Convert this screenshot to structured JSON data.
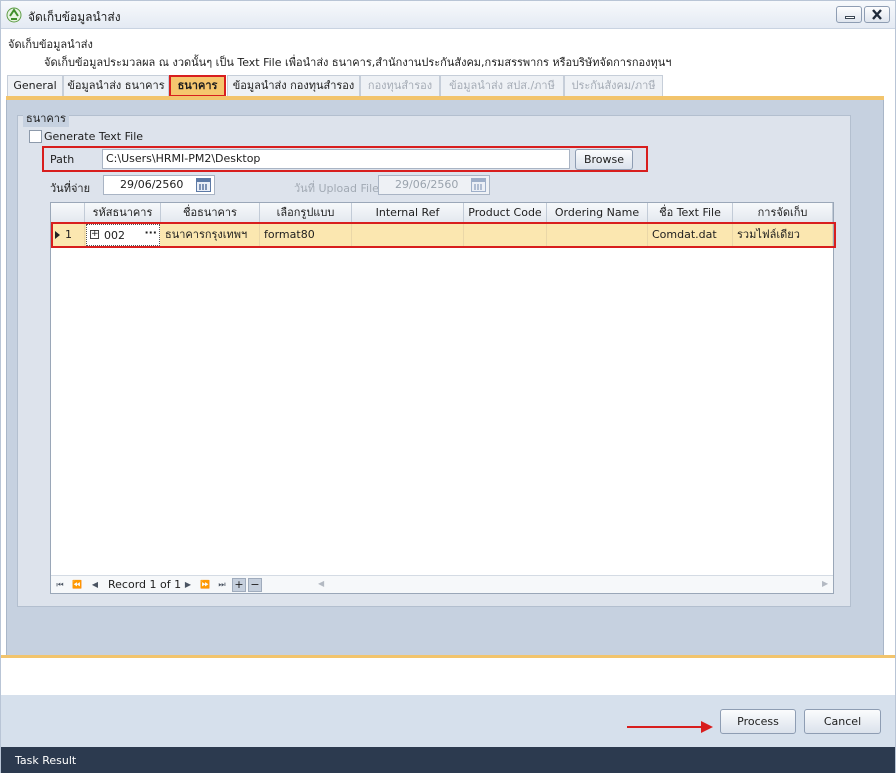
{
  "window": {
    "title": "จัดเก็บข้อมูลนำส่ง",
    "icon": "recycle-app-icon"
  },
  "description": {
    "title": "จัดเก็บข้อมูลนำส่ง",
    "body": "จัดเก็บข้อมูลประมวลผล ณ งวดนั้นๆ เป็น Text File เพื่อนำส่ง ธนาคาร,สำนักงานประกันสังคม,กรมสรรพากร หรือบริษัทจัดการกองทุนฯ"
  },
  "tabs": [
    {
      "label": "General",
      "state": "normal"
    },
    {
      "label": "ข้อมูลนำส่ง ธนาคาร",
      "state": "normal"
    },
    {
      "label": "ธนาคาร",
      "state": "active"
    },
    {
      "label": "ข้อมูลนำส่ง กองทุนสำรอง",
      "state": "normal"
    },
    {
      "label": "กองทุนสำรอง",
      "state": "disabled"
    },
    {
      "label": "ข้อมูลนำส่ง สปส./ภาษี",
      "state": "disabled"
    },
    {
      "label": "ประกันสังคม/ภาษี",
      "state": "disabled"
    }
  ],
  "group": {
    "title": "ธนาคาร",
    "generate_label": "Generate Text File",
    "generate_checked": false,
    "path_label": "Path",
    "path_value": "C:\\Users\\HRMI-PM2\\Desktop",
    "browse_label": "Browse",
    "pay_date_label": "วันที่จ่าย",
    "pay_date_value": "29/06/2560",
    "upload_label": "วันที่ Upload File",
    "upload_value": "29/06/2560"
  },
  "grid": {
    "columns": [
      "รหัสธนาคาร",
      "ชื่อธนาคาร",
      "เลือกรูปแบบ",
      "Internal Ref",
      "Product Code",
      "Ordering Name",
      "ชื่อ Text File",
      "การจัดเก็บ"
    ],
    "rows": [
      {
        "num": "1",
        "code": "002",
        "name": "ธนาคารกรุงเทพฯ",
        "format": "format80",
        "internal_ref": "",
        "product_code": "",
        "ordering_name": "",
        "text_file": "Comdat.dat",
        "storage": "รวมไฟล์เดียว"
      }
    ],
    "navigator": {
      "record_text": "Record 1 of 1"
    }
  },
  "footer": {
    "process_label": "Process",
    "cancel_label": "Cancel"
  },
  "status": {
    "text": "Task Result"
  },
  "colors": {
    "accent": "#f2c46c",
    "highlight_outline": "#d81e1e",
    "panel_bg": "#c6d1e0",
    "row_selected": "#fbe7b0",
    "status_bar": "#2c3a4f"
  }
}
